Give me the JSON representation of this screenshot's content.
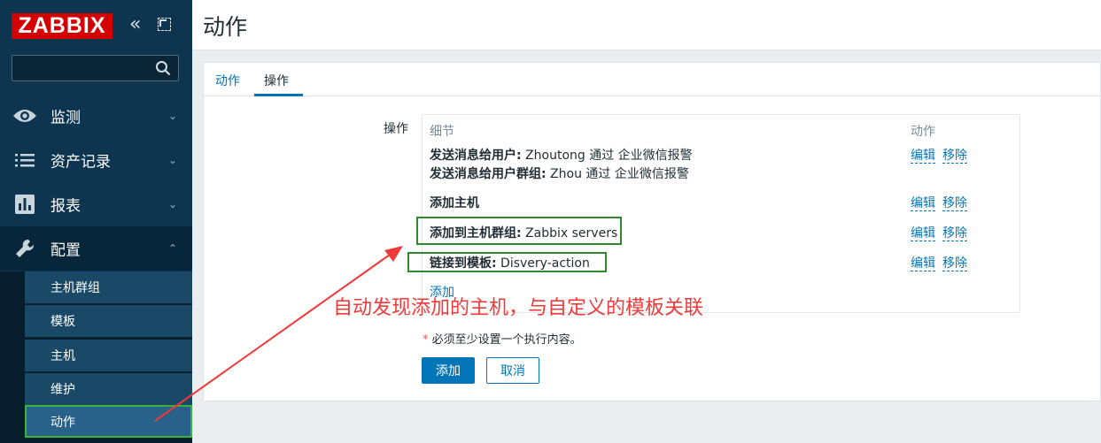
{
  "sidebar": {
    "logo": "ZABBIX",
    "collapse_icon": "double-chevron-left-icon",
    "kiosk_icon": "fullscreen-icon",
    "search": {
      "value": "",
      "placeholder": ""
    },
    "menu": [
      {
        "label": "监测",
        "icon": "eye-icon"
      },
      {
        "label": "资产记录",
        "icon": "list-icon"
      },
      {
        "label": "报表",
        "icon": "bar-chart-icon"
      },
      {
        "label": "配置",
        "icon": "wrench-icon"
      }
    ],
    "submenu": [
      "主机群组",
      "模板",
      "主机",
      "维护",
      "动作"
    ]
  },
  "page": {
    "title": "动作",
    "tabs": [
      "动作",
      "操作"
    ],
    "active_tab": "操作"
  },
  "operations": {
    "field_label": "操作",
    "columns": {
      "detail": "细节",
      "action": "动作"
    },
    "rows": [
      {
        "lines": [
          {
            "bold": "发送消息给用户:",
            "text": " Zhoutong 通过 企业微信报警"
          },
          {
            "bold": "发送消息给用户群组:",
            "text": " Zhou 通过 企业微信报警"
          }
        ],
        "edit": "编辑",
        "remove": "移除"
      },
      {
        "lines": [
          {
            "bold": "添加主机",
            "text": ""
          }
        ],
        "edit": "编辑",
        "remove": "移除"
      },
      {
        "lines": [
          {
            "bold": "添加到主机群组:",
            "text": " Zabbix servers"
          }
        ],
        "edit": "编辑",
        "remove": "移除"
      },
      {
        "lines": [
          {
            "bold": "链接到模板:",
            "text": " Disvery-action"
          }
        ],
        "edit": "编辑",
        "remove": "移除"
      }
    ],
    "add_link": "添加"
  },
  "form": {
    "required_star": "*",
    "required_note": " 必须至少设置一个执行内容。",
    "add_button": "添加",
    "cancel_button": "取消"
  },
  "annotation": {
    "text": "自动发现添加的主机，与自定义的模板关联",
    "color": "#f03a3a",
    "box_color": "#2f8a2f"
  }
}
